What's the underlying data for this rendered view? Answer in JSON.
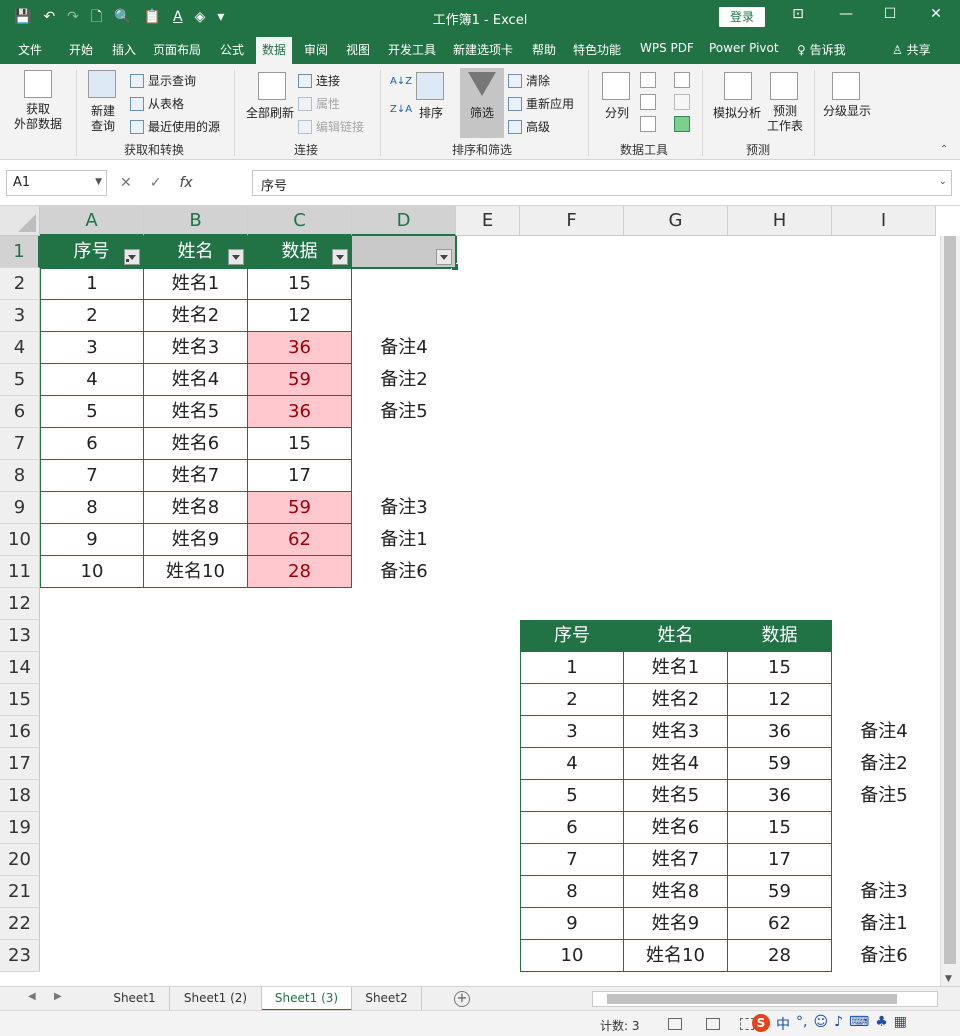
{
  "window": {
    "title": "工作簿1  -  Excel",
    "login_label": "登录",
    "qat_icons": [
      "save-icon",
      "undo-icon",
      "redo-icon",
      "new-icon",
      "print-preview-icon",
      "paste-icon",
      "font-color-icon",
      "fill-color-icon",
      "customize-icon"
    ]
  },
  "menu": {
    "tabs": [
      "文件",
      "开始",
      "插入",
      "页面布局",
      "公式",
      "数据",
      "审阅",
      "视图",
      "开发工具",
      "新建选项卡",
      "帮助",
      "特色功能",
      "WPS PDF",
      "Power Pivot"
    ],
    "active": "数据",
    "tell_me": "告诉我",
    "share": "共享"
  },
  "ribbon": {
    "get_external": "获取\n外部数据",
    "new_query": "新建\n查询",
    "show_queries": "显示查询",
    "from_table": "从表格",
    "recent_sources": "最近使用的源",
    "group_get_transform": "获取和转换",
    "refresh_all": "全部刷新",
    "connections": "连接",
    "properties": "属性",
    "edit_links": "编辑链接",
    "group_connections": "连接",
    "sort": "排序",
    "filter": "筛选",
    "clear": "清除",
    "reapply": "重新应用",
    "advanced": "高级",
    "group_sort_filter": "排序和筛选",
    "text_to_columns": "分列",
    "group_data_tools": "数据工具",
    "what_if": "模拟分析",
    "forecast_sheet": "预测\n工作表",
    "group_forecast": "预测",
    "outline": "分级显示"
  },
  "formula_bar": {
    "name_box": "A1",
    "cancel": "✕",
    "enter": "✓",
    "fx": "fx",
    "value": "序号"
  },
  "columns": [
    "A",
    "B",
    "C",
    "D",
    "E",
    "F",
    "G",
    "H",
    "I"
  ],
  "rows": [
    "1",
    "2",
    "3",
    "4",
    "5",
    "6",
    "7",
    "8",
    "9",
    "10",
    "11",
    "12",
    "13",
    "14",
    "15",
    "16",
    "17",
    "18",
    "19",
    "20",
    "21",
    "22",
    "23"
  ],
  "table1": {
    "headers": [
      "序号",
      "姓名",
      "数据"
    ],
    "rows": [
      [
        "1",
        "姓名1",
        "15"
      ],
      [
        "2",
        "姓名2",
        "12"
      ],
      [
        "3",
        "姓名3",
        "36"
      ],
      [
        "4",
        "姓名4",
        "59"
      ],
      [
        "5",
        "姓名5",
        "36"
      ],
      [
        "6",
        "姓名6",
        "15"
      ],
      [
        "7",
        "姓名7",
        "17"
      ],
      [
        "8",
        "姓名8",
        "59"
      ],
      [
        "9",
        "姓名9",
        "62"
      ],
      [
        "10",
        "姓名10",
        "28"
      ]
    ],
    "notes": [
      "",
      "",
      "备注4",
      "备注2",
      "备注5",
      "",
      "",
      "备注3",
      "备注1",
      "备注6"
    ],
    "highlight": [
      false,
      false,
      true,
      true,
      true,
      false,
      false,
      true,
      true,
      true
    ]
  },
  "table2": {
    "headers": [
      "序号",
      "姓名",
      "数据"
    ],
    "rows": [
      [
        "1",
        "姓名1",
        "15"
      ],
      [
        "2",
        "姓名2",
        "12"
      ],
      [
        "3",
        "姓名3",
        "36"
      ],
      [
        "4",
        "姓名4",
        "59"
      ],
      [
        "5",
        "姓名5",
        "36"
      ],
      [
        "6",
        "姓名6",
        "15"
      ],
      [
        "7",
        "姓名7",
        "17"
      ],
      [
        "8",
        "姓名8",
        "59"
      ],
      [
        "9",
        "姓名9",
        "62"
      ],
      [
        "10",
        "姓名10",
        "28"
      ]
    ],
    "notes": [
      "",
      "",
      "备注4",
      "备注2",
      "备注5",
      "",
      "",
      "备注3",
      "备注1",
      "备注6"
    ]
  },
  "sheets": [
    "Sheet1",
    "Sheet1 (2)",
    "Sheet1 (3)",
    "Sheet2"
  ],
  "active_sheet": "Sheet1 (3)",
  "status": {
    "count": "计数: 3"
  },
  "colors": {
    "accent": "#217346",
    "highlight_bg": "#ffc7ce",
    "highlight_fg": "#9c0006"
  }
}
